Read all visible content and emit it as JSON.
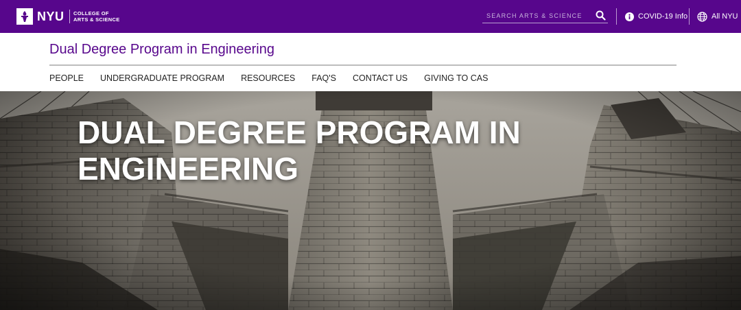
{
  "topbar": {
    "brand": "NYU",
    "school_line1": "COLLEGE OF",
    "school_line2": "ARTS & SCIENCE",
    "search_placeholder": "SEARCH ARTS & SCIENCE",
    "covid_label": "COVID-19 Info",
    "all_nyu_label": "All NYU",
    "color": "#57068c"
  },
  "site": {
    "title": "Dual Degree Program in Engineering"
  },
  "nav": {
    "items": [
      "PEOPLE",
      "UNDERGRADUATE PROGRAM",
      "RESOURCES",
      "FAQ'S",
      "CONTACT US",
      "GIVING TO CAS"
    ]
  },
  "hero": {
    "title": "DUAL DEGREE PROGRAM IN ENGINEERING",
    "image": "stone-bridge-tower-photo"
  },
  "icons": {
    "logo": "nyu-torch-icon",
    "search": "search-icon",
    "covid": "info-icon",
    "all_nyu": "globe-icon"
  }
}
